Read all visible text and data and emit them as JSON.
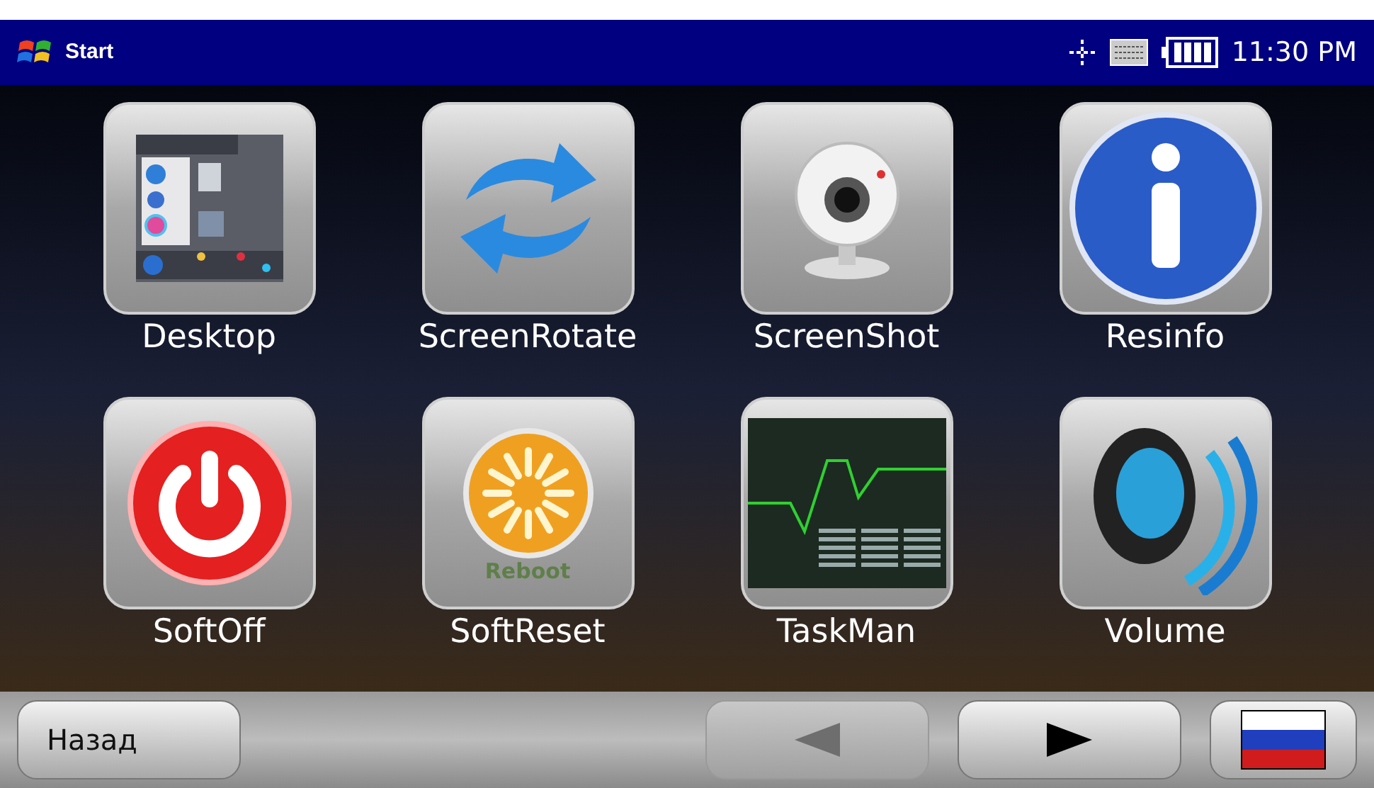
{
  "taskbar": {
    "start_label": "Start",
    "clock": "11:30 PM"
  },
  "apps": [
    {
      "label": "Desktop",
      "kind": "desktop"
    },
    {
      "label": "ScreenRotate",
      "kind": "rotate"
    },
    {
      "label": "ScreenShot",
      "kind": "webcam"
    },
    {
      "label": "Resinfo",
      "kind": "info"
    },
    {
      "label": "SoftOff",
      "kind": "power"
    },
    {
      "label": "SoftReset",
      "kind": "reboot",
      "caption": "Reboot"
    },
    {
      "label": "TaskMan",
      "kind": "taskman"
    },
    {
      "label": "Volume",
      "kind": "speaker"
    }
  ],
  "bottom_bar": {
    "back_label": "Назад",
    "prev_disabled": true,
    "next_disabled": false
  }
}
